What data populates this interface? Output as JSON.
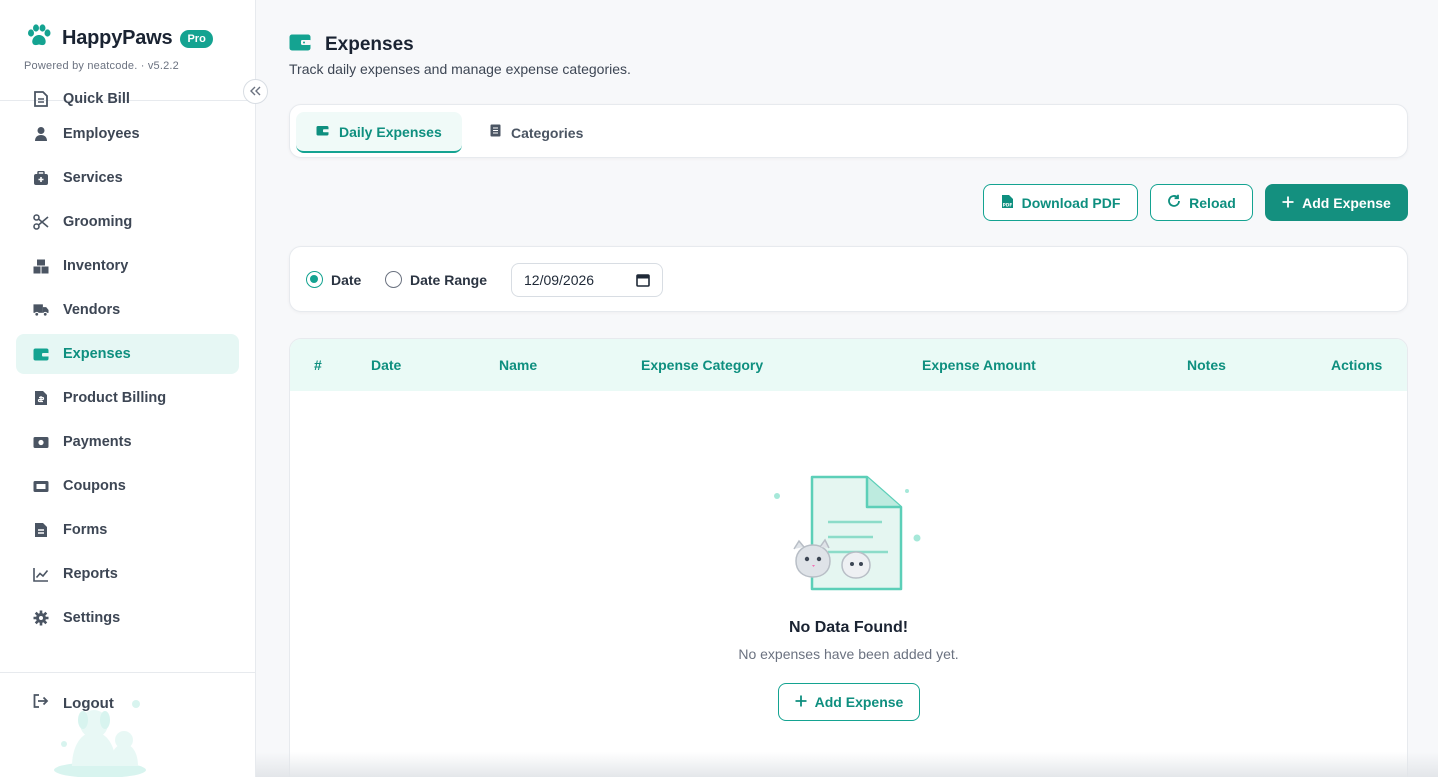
{
  "brand": {
    "name": "HappyPaws",
    "badge": "Pro",
    "powered_by": "Powered by neatcode. · v5.2.2",
    "accent": "#14a391"
  },
  "sidebar": {
    "items": [
      {
        "label": "Quick Bill",
        "icon": "file-icon"
      },
      {
        "label": "Employees",
        "icon": "user-icon"
      },
      {
        "label": "Services",
        "icon": "medkit-icon"
      },
      {
        "label": "Grooming",
        "icon": "scissors-icon"
      },
      {
        "label": "Inventory",
        "icon": "boxes-icon"
      },
      {
        "label": "Vendors",
        "icon": "truck-icon"
      },
      {
        "label": "Expenses",
        "icon": "wallet-icon",
        "active": true
      },
      {
        "label": "Product Billing",
        "icon": "invoice-icon"
      },
      {
        "label": "Payments",
        "icon": "money-icon"
      },
      {
        "label": "Coupons",
        "icon": "ticket-icon"
      },
      {
        "label": "Forms",
        "icon": "form-icon"
      },
      {
        "label": "Reports",
        "icon": "chart-line-icon"
      },
      {
        "label": "Settings",
        "icon": "gear-icon"
      }
    ],
    "logout_label": "Logout"
  },
  "header": {
    "title": "Expenses",
    "subtitle": "Track daily expenses and manage expense categories."
  },
  "tabs": [
    {
      "label": "Daily Expenses",
      "active": true
    },
    {
      "label": "Categories",
      "active": false
    }
  ],
  "toolbar": {
    "download_label": "Download PDF",
    "reload_label": "Reload",
    "add_label": "Add Expense"
  },
  "filter": {
    "date_label": "Date",
    "range_label": "Date Range",
    "selected": "Date",
    "date_value": "12/09/2026"
  },
  "table": {
    "columns": [
      "#",
      "Date",
      "Name",
      "Expense Category",
      "Expense Amount",
      "Notes",
      "Actions"
    ]
  },
  "empty_state": {
    "title": "No Data Found!",
    "subtitle": "No expenses have been added yet.",
    "button_label": "Add Expense"
  }
}
